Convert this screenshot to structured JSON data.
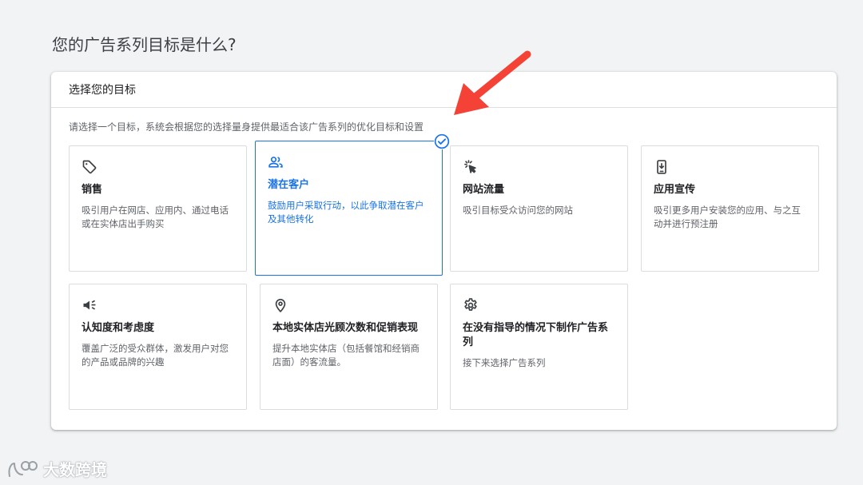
{
  "page": {
    "title": "您的广告系列目标是什么?"
  },
  "panel": {
    "header": "选择您的目标",
    "description": "请选择一个目标，系统会根据您的选择量身提供最适合该广告系列的优化目标和设置"
  },
  "goals": [
    {
      "title": "销售",
      "description": "吸引用户在网店、应用内、通过电话或在实体店出手购买",
      "icon": "tag-icon"
    },
    {
      "title": "潜在客户",
      "description": "鼓励用户采取行动，以此争取潜在客户及其他转化",
      "icon": "people-icon",
      "selected": true
    },
    {
      "title": "网站流量",
      "description": "吸引目标受众访问您的网站",
      "icon": "cursor-click-icon"
    },
    {
      "title": "应用宣传",
      "description": "吸引更多用户安装您的应用、与之互动并进行预注册",
      "icon": "phone-download-icon"
    },
    {
      "title": "认知度和考虑度",
      "description": "覆盖广泛的受众群体，激发用户对您的产品或品牌的兴趣",
      "icon": "megaphone-icon"
    },
    {
      "title": "本地实体店光顾次数和促销表现",
      "description": "提升本地实体店（包括餐馆和经销商店面）的客流量。",
      "icon": "location-pin-icon"
    },
    {
      "title": "在没有指导的情况下制作广告系列",
      "description": "接下来选择广告系列",
      "icon": "gear-icon"
    }
  ],
  "watermark": {
    "text": "大数跨境"
  },
  "colors": {
    "accent": "#1a73e8",
    "arrow": "#f44336",
    "border": "#dadce0",
    "text_secondary": "#5f6368"
  }
}
